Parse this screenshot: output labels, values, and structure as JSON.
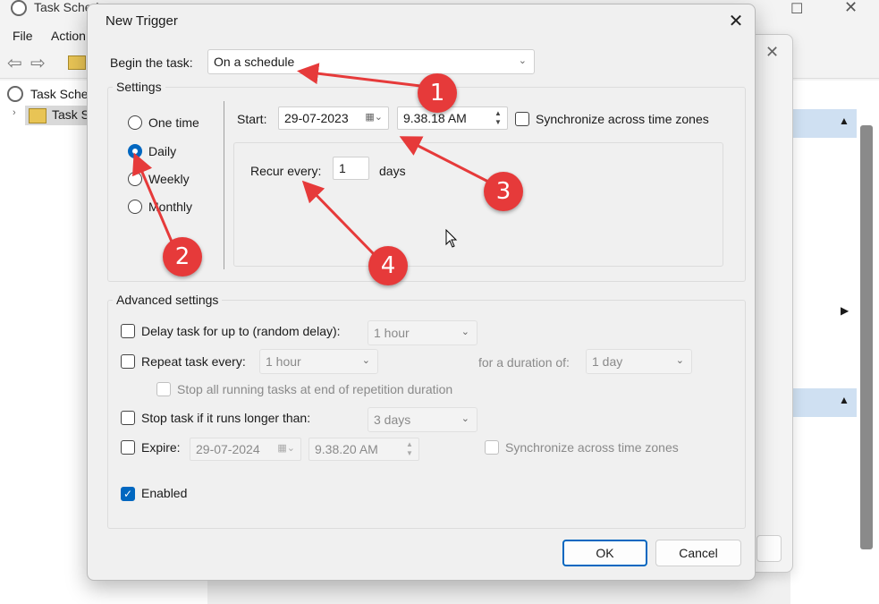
{
  "background_app": {
    "title": "Task Schedu",
    "menu": [
      "File",
      "Action"
    ],
    "tree_items": [
      "Task Sche",
      "Task S"
    ]
  },
  "dialog": {
    "title": "New Trigger",
    "begin_label": "Begin the task:",
    "begin_value": "On a schedule",
    "settings_label": "Settings",
    "radios": [
      {
        "label": "One time",
        "checked": false
      },
      {
        "label": "Daily",
        "checked": true
      },
      {
        "label": "Weekly",
        "checked": false
      },
      {
        "label": "Monthly",
        "checked": false
      }
    ],
    "start_label": "Start:",
    "start_date": "29-07-2023",
    "start_time": "9.38.18 AM",
    "sync_label": "Synchronize across time zones",
    "recur_label": "Recur every:",
    "recur_value": "1",
    "recur_unit": "days",
    "advanced_label": "Advanced settings",
    "delay": {
      "label": "Delay task for up to (random delay):",
      "value": "1 hour"
    },
    "repeat": {
      "label": "Repeat task every:",
      "value": "1 hour",
      "duration_label": "for a duration of:",
      "duration_value": "1 day"
    },
    "stop_all_label": "Stop all running tasks at end of repetition duration",
    "stop_longer": {
      "label": "Stop task if it runs longer than:",
      "value": "3 days"
    },
    "expire": {
      "label": "Expire:",
      "date": "29-07-2024",
      "time": "9.38.20 AM",
      "sync_label": "Synchronize across time zones"
    },
    "enabled_label": "Enabled",
    "ok": "OK",
    "cancel": "Cancel"
  },
  "annotations": [
    "1",
    "2",
    "3",
    "4"
  ],
  "colors": {
    "accent": "#0067c0",
    "annotation": "#e63a3a"
  }
}
